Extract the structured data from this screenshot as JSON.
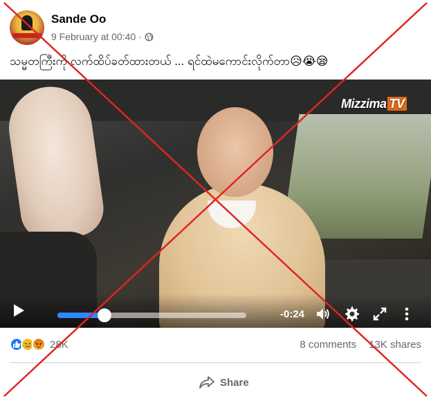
{
  "post": {
    "author": "Sande Oo",
    "timestamp": "9 February at 00:40",
    "separator": "·",
    "caption": "သမ္မတကြီးကို လက်ထိပ်ခတ်ထားတယ် ... ရင်ထဲမကောင်းလိုက်တာ😥😭😪"
  },
  "video": {
    "watermark_brand": "Mizzima",
    "watermark_tv": "TV",
    "time_remaining": "-0:24",
    "progress_fraction": 0.25
  },
  "footer": {
    "reaction_count": "28K",
    "comments": "8 comments",
    "shares": "13K shares",
    "share_label": "Share"
  },
  "icons": {
    "privacy": "globe-icon",
    "play": "play-icon",
    "volume": "volume-icon",
    "settings": "gear-icon",
    "fullscreen": "fullscreen-icon",
    "more": "more-vertical-icon",
    "share": "share-arrow-icon"
  },
  "colors": {
    "accent": "#1877f2",
    "progress": "#2d88ff",
    "overlay_x": "#e02424",
    "meta_text": "#65676b"
  }
}
